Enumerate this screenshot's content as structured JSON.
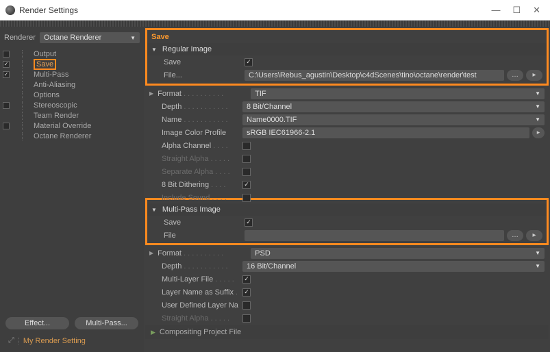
{
  "window": {
    "title": "Render Settings",
    "min": "—",
    "max": "☐",
    "close": "✕"
  },
  "left": {
    "renderer_label": "Renderer",
    "renderer_value": "Octane Renderer",
    "items": {
      "output": "Output",
      "save": "Save",
      "multipass": "Multi-Pass",
      "aa": "Anti-Aliasing",
      "options": "Options",
      "stereo": "Stereoscopic",
      "team": "Team Render",
      "override": "Material Override",
      "octane": "Octane Renderer"
    },
    "effect_btn": "Effect...",
    "multipass_btn": "Multi-Pass...",
    "render_setting": "My Render Setting"
  },
  "right": {
    "header": "Save",
    "regular": {
      "title": "Regular Image",
      "save_l": "Save",
      "file_l": "File...",
      "file_v": "C:\\Users\\Rebus_agustin\\Desktop\\c4dScenes\\tino\\octane\\render\\test",
      "format_l": "Format",
      "format_v": "TIF",
      "depth_l": "Depth",
      "depth_v": "8 Bit/Channel",
      "name_l": "Name",
      "name_v": "Name0000.TIF",
      "icp_l": "Image Color Profile",
      "icp_v": "sRGB IEC61966-2.1",
      "alpha_l": "Alpha Channel",
      "straight_l": "Straight Alpha",
      "sep_l": "Separate Alpha",
      "dither_l": "8 Bit Dithering",
      "sound_l": "Include Sound"
    },
    "multipass": {
      "title": "Multi-Pass Image",
      "save_l": "Save",
      "file_l": "File",
      "format_l": "Format",
      "format_v": "PSD",
      "depth_l": "Depth",
      "depth_v": "16 Bit/Channel",
      "mlayer_l": "Multi-Layer File",
      "lname_l": "Layer Name as Suffix",
      "udln_l": "User Defined Layer Name",
      "straight_l": "Straight Alpha"
    },
    "compositing": "Compositing Project File"
  }
}
